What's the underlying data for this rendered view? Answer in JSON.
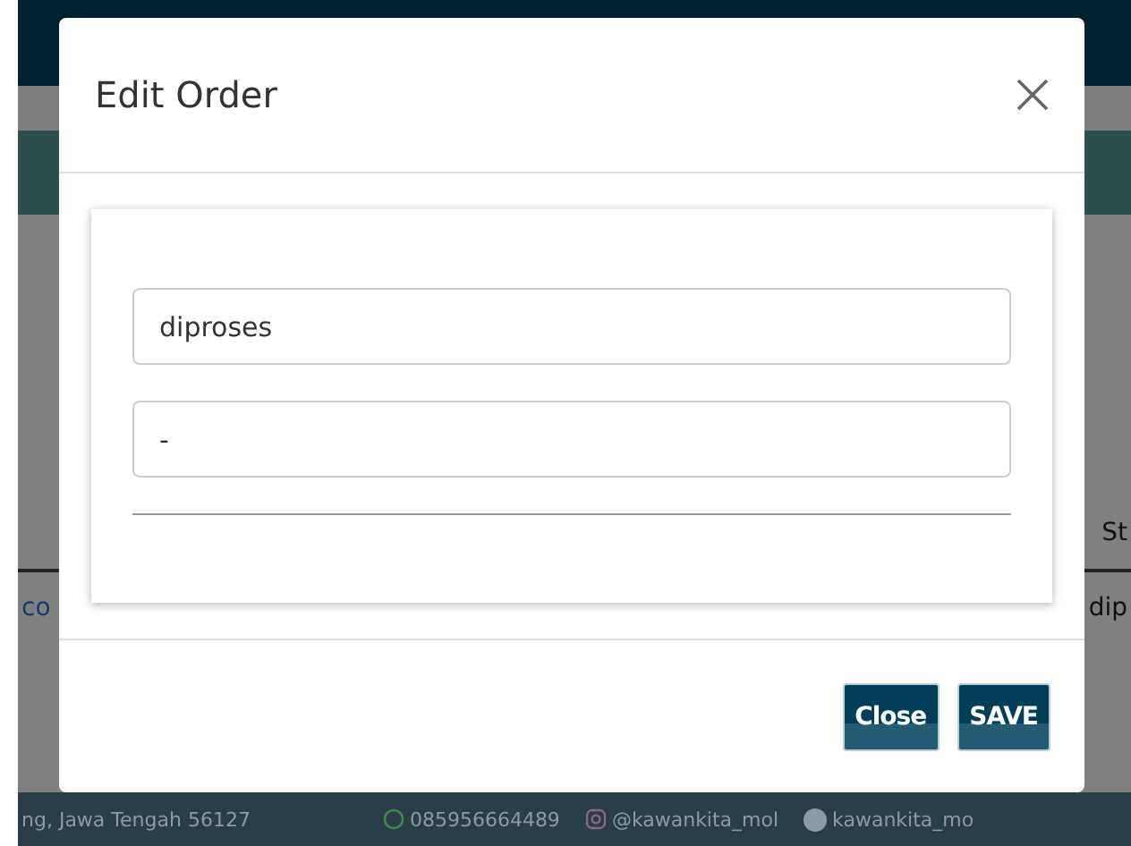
{
  "background": {
    "table": {
      "header": [
        "St"
      ],
      "row": [
        "co",
        "dip"
      ]
    },
    "footer": {
      "address": "ng, Jawa Tengah 56127",
      "phone": "085956664489",
      "instagram": "@kawankita_mol",
      "facebook": "kawankita_mo"
    }
  },
  "modal": {
    "title": "Edit Order",
    "fields": [
      {
        "value": "diproses"
      },
      {
        "value": "-"
      }
    ],
    "buttons": [
      "Close",
      "SAVE"
    ]
  }
}
